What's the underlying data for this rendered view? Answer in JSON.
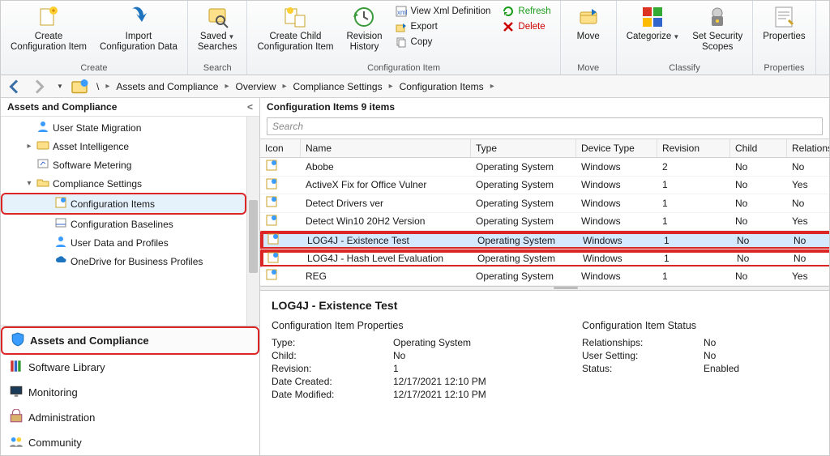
{
  "ribbon": {
    "groups": [
      {
        "label": "Create",
        "large": [
          {
            "id": "create-ci",
            "line1": "Create",
            "line2": "Configuration Item"
          },
          {
            "id": "import-cd",
            "line1": "Import",
            "line2": "Configuration Data"
          }
        ],
        "small": []
      },
      {
        "label": "Search",
        "large": [
          {
            "id": "saved-searches",
            "line1": "Saved",
            "line2": "Searches",
            "dropdown": true
          }
        ],
        "small": []
      },
      {
        "label": "Configuration Item",
        "large": [
          {
            "id": "create-child-ci",
            "line1": "Create Child",
            "line2": "Configuration Item"
          },
          {
            "id": "rev-history",
            "line1": "Revision",
            "line2": "History"
          }
        ],
        "small": [
          {
            "id": "view-xml",
            "text": "View Xml Definition"
          },
          {
            "id": "export",
            "text": "Export"
          },
          {
            "id": "copy",
            "text": "Copy"
          },
          {
            "id": "refresh",
            "text": "Refresh"
          },
          {
            "id": "delete",
            "text": "Delete"
          }
        ]
      },
      {
        "label": "Move",
        "large": [
          {
            "id": "move",
            "line1": "Move",
            "line2": ""
          }
        ],
        "small": []
      },
      {
        "label": "Classify",
        "large": [
          {
            "id": "categorize",
            "line1": "Categorize",
            "line2": "",
            "dropdown": true
          },
          {
            "id": "set-security",
            "line1": "Set Security",
            "line2": "Scopes"
          }
        ],
        "small": []
      },
      {
        "label": "Properties",
        "large": [
          {
            "id": "properties",
            "line1": "Properties",
            "line2": ""
          }
        ],
        "small": []
      }
    ]
  },
  "breadcrumb": [
    "\\",
    "Assets and Compliance",
    "Overview",
    "Compliance Settings",
    "Configuration Items"
  ],
  "leftPanel": {
    "title": "Assets and Compliance",
    "tree": [
      {
        "label": "User State Migration",
        "depth": 1,
        "icon": "user"
      },
      {
        "label": "Asset Intelligence",
        "depth": 1,
        "icon": "folder",
        "expander": "▸"
      },
      {
        "label": "Software Metering",
        "depth": 1,
        "icon": "meter"
      },
      {
        "label": "Compliance Settings",
        "depth": 1,
        "icon": "folder-open",
        "expander": "▾"
      },
      {
        "label": "Configuration Items",
        "depth": 2,
        "icon": "ci",
        "selected": true,
        "red": true
      },
      {
        "label": "Configuration Baselines",
        "depth": 2,
        "icon": "baseline"
      },
      {
        "label": "User Data and Profiles",
        "depth": 2,
        "icon": "user"
      },
      {
        "label": "OneDrive for Business Profiles",
        "depth": 2,
        "icon": "cloud"
      }
    ]
  },
  "wunderbar": [
    {
      "label": "Assets and Compliance",
      "icon": "shield",
      "active": true,
      "red": true
    },
    {
      "label": "Software Library",
      "icon": "books"
    },
    {
      "label": "Monitoring",
      "icon": "monitor"
    },
    {
      "label": "Administration",
      "icon": "admin"
    },
    {
      "label": "Community",
      "icon": "community"
    }
  ],
  "list": {
    "title": "Configuration Items 9 items",
    "searchPlaceholder": "Search",
    "columns": [
      "Icon",
      "Name",
      "Type",
      "Device Type",
      "Revision",
      "Child",
      "Relationships"
    ],
    "rows": [
      {
        "name": "Abobe",
        "type": "Operating System",
        "device": "Windows",
        "rev": "2",
        "child": "No",
        "rel": "No"
      },
      {
        "name": "ActiveX Fix for Office Vulner",
        "type": "Operating System",
        "device": "Windows",
        "rev": "1",
        "child": "No",
        "rel": "Yes"
      },
      {
        "name": "Detect Drivers ver",
        "type": "Operating System",
        "device": "Windows",
        "rev": "1",
        "child": "No",
        "rel": "No"
      },
      {
        "name": "Detect Win10 20H2 Version",
        "type": "Operating System",
        "device": "Windows",
        "rev": "1",
        "child": "No",
        "rel": "Yes"
      },
      {
        "name": "LOG4J - Existence Test",
        "type": "Operating System",
        "device": "Windows",
        "rev": "1",
        "child": "No",
        "rel": "No",
        "selected": true,
        "red": true
      },
      {
        "name": "LOG4J - Hash Level Evaluation",
        "type": "Operating System",
        "device": "Windows",
        "rev": "1",
        "child": "No",
        "rel": "No",
        "red": true
      },
      {
        "name": "REG",
        "type": "Operating System",
        "device": "Windows",
        "rev": "1",
        "child": "No",
        "rel": "Yes"
      }
    ]
  },
  "detail": {
    "title": "LOG4J - Existence Test",
    "leftTitle": "Configuration Item Properties",
    "rightTitle": "Configuration Item Status",
    "leftKV": [
      {
        "k": "Type:",
        "v": "Operating System"
      },
      {
        "k": "Child:",
        "v": "No"
      },
      {
        "k": "Revision:",
        "v": "1"
      },
      {
        "k": "Date Created:",
        "v": "12/17/2021 12:10 PM"
      },
      {
        "k": "Date Modified:",
        "v": "12/17/2021 12:10 PM"
      }
    ],
    "rightKV": [
      {
        "k": "Relationships:",
        "v": "No"
      },
      {
        "k": "User Setting:",
        "v": "No"
      },
      {
        "k": "Status:",
        "v": "Enabled"
      }
    ]
  }
}
